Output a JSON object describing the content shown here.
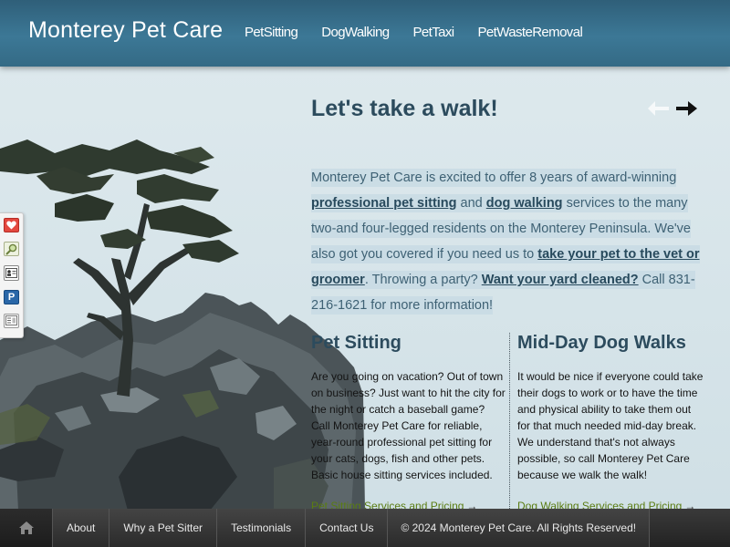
{
  "header": {
    "site_title": "Monterey Pet Care",
    "nav": [
      "PetSitting",
      "DogWalking",
      "PetTaxi",
      "PetWasteRemoval"
    ]
  },
  "social": {
    "icons": [
      "heart-icon",
      "search-icon",
      "contact-card-icon",
      "p-badge-icon",
      "news-icon"
    ]
  },
  "main": {
    "heading": "Let's take a walk!",
    "intro": {
      "t1": "Monterey Pet Care is excited to offer 8 years of award-winning ",
      "l1": "professional pet sitting",
      "t2": " and ",
      "l2": "dog walking",
      "t3": " services to the many two-and four-legged residents on the Monterey Peninsula. We've also got you covered if you need us to ",
      "l3": "take your pet to the vet or groomer",
      "t4": ". Throwing a party? ",
      "l4": "Want your yard cleaned?",
      "t5": " Call 831-216-1621 for more information!"
    },
    "left_col": {
      "title": "Pet Sitting",
      "text": "Are you going on vacation? Out of town on business? Just want to hit the city for the night or catch a baseball game? Call Monterey Pet Care for reliable, year-round professional pet sitting for your cats, dogs, fish and other pets. Basic house sitting services included.",
      "link": "Pet Sitting Services and Pricing",
      "link_arrow": "→"
    },
    "right_col": {
      "title": "Mid-Day Dog Walks",
      "text": "It would be nice if everyone could take their dogs to work or to have the time and physical ability to take them out for that much needed mid-day break. We understand that's not always possible, so call Monterey Pet Care because we walk the walk!",
      "link": "Dog Walking Services and Pricing",
      "link_arrow": "→"
    }
  },
  "footer": {
    "items": [
      "About",
      "Why a Pet Sitter",
      "Testimonials",
      "Contact Us"
    ],
    "copyright": "© 2024 Monterey Pet Care. All Rights Reserved!"
  },
  "colors": {
    "header": "#3c7896",
    "heading_text": "#2c4b5d",
    "link_green": "#5a7c12",
    "footer": "#2b2b2b"
  }
}
